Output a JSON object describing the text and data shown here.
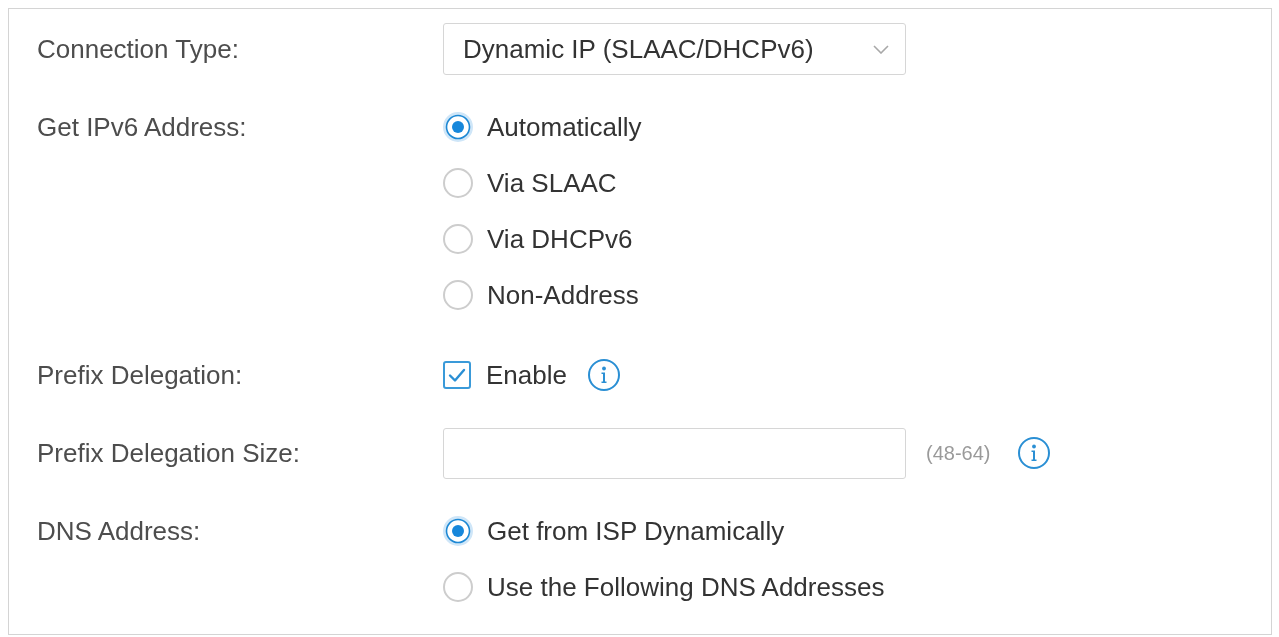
{
  "panel": {
    "fields": [
      {
        "kind": "select",
        "label": "Connection Type:",
        "value": "Dynamic IP (SLAAC/DHCPv6)"
      },
      {
        "kind": "radio",
        "label": "Get IPv6 Address:",
        "options": [
          {
            "label": "Automatically",
            "selected": true
          },
          {
            "label": "Via SLAAC",
            "selected": false
          },
          {
            "label": "Via DHCPv6",
            "selected": false
          },
          {
            "label": "Non-Address",
            "selected": false
          }
        ]
      },
      {
        "kind": "checkbox",
        "label": "Prefix Delegation:",
        "option": "Enable",
        "checked": true,
        "info": true
      },
      {
        "kind": "text",
        "label": "Prefix Delegation Size:",
        "range": "(48-64)",
        "info": true
      },
      {
        "kind": "radio",
        "label": "DNS Address:",
        "options": [
          {
            "label": "Get from ISP Dynamically",
            "selected": true
          },
          {
            "label": "Use the Following DNS Addresses",
            "selected": false
          }
        ]
      }
    ]
  }
}
